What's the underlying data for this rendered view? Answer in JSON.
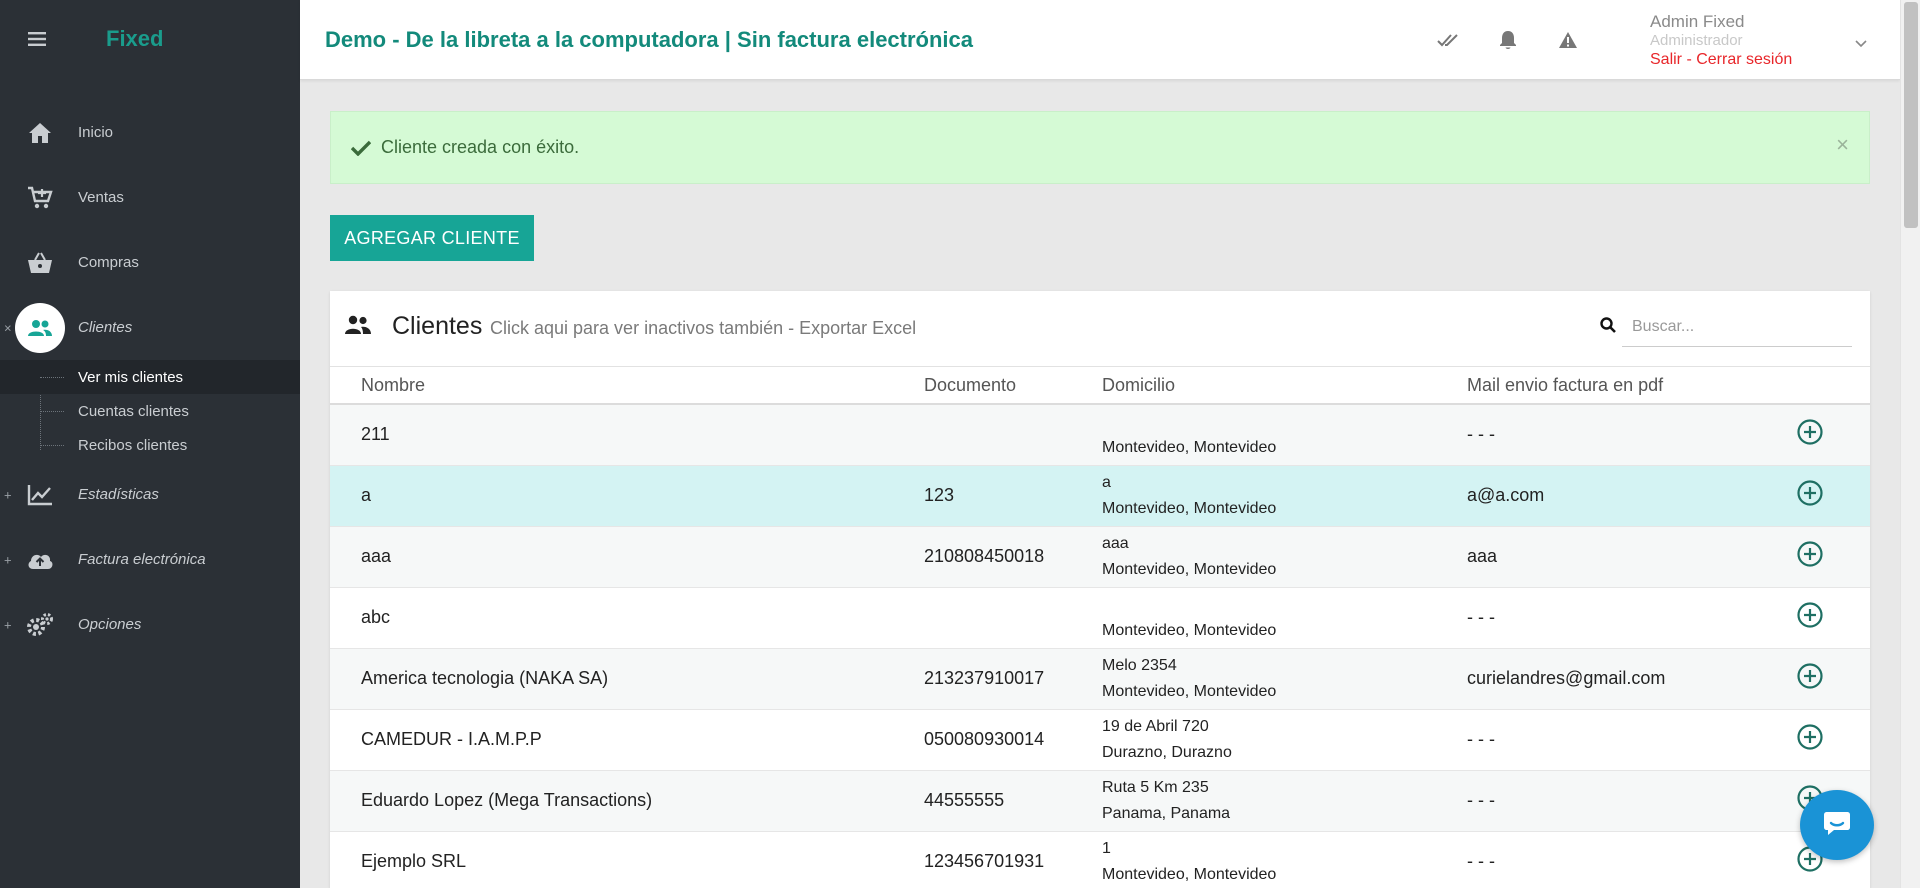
{
  "app": {
    "brand": "Fixed",
    "page_title": "Demo - De la libreta a la computadora | Sin factura electrónica"
  },
  "user": {
    "name": "Admin Fixed",
    "role": "Administrador",
    "logout": "Salir - Cerrar sesión"
  },
  "sidebar": {
    "items": [
      {
        "label": "Inicio",
        "icon": "home-icon"
      },
      {
        "label": "Ventas",
        "icon": "cart-icon"
      },
      {
        "label": "Compras",
        "icon": "basket-icon"
      },
      {
        "label": "Clientes",
        "icon": "users-icon",
        "marker": "×"
      },
      {
        "label": "Estadísticas",
        "icon": "chart-icon",
        "marker": "+"
      },
      {
        "label": "Factura electrónica",
        "icon": "cloud-upload-icon",
        "marker": "+"
      },
      {
        "label": "Opciones",
        "icon": "gears-icon",
        "marker": "+"
      }
    ],
    "clientes_sub": [
      "Ver mis clientes",
      "Cuentas clientes",
      "Recibos clientes"
    ]
  },
  "alert": {
    "message": "Cliente creada con éxito.",
    "close": "×"
  },
  "add_button": "AGREGAR CLIENTE",
  "card": {
    "title": "Clientes",
    "subtitle": "Click aqui para ver inactivos también - Exportar Excel",
    "search_placeholder": "Buscar..."
  },
  "table": {
    "headers": [
      "Nombre",
      "Documento",
      "Domicilio",
      "Mail envio factura en pdf"
    ],
    "rows": [
      {
        "nombre": "211",
        "documento": "",
        "dom1": "",
        "dom2": "Montevideo, Montevideo",
        "mail": "- - -"
      },
      {
        "nombre": "a",
        "documento": "123",
        "dom1": "a",
        "dom2": "Montevideo, Montevideo",
        "mail": "a@a.com"
      },
      {
        "nombre": "aaa",
        "documento": "210808450018",
        "dom1": "aaa",
        "dom2": "Montevideo, Montevideo",
        "mail": "aaa"
      },
      {
        "nombre": "abc",
        "documento": "",
        "dom1": "",
        "dom2": "Montevideo, Montevideo",
        "mail": "- - -"
      },
      {
        "nombre": "America tecnologia (NAKA SA)",
        "documento": "213237910017",
        "dom1": "Melo 2354",
        "dom2": "Montevideo, Montevideo",
        "mail": "curielandres@gmail.com"
      },
      {
        "nombre": "CAMEDUR - I.A.M.P.P",
        "documento": "050080930014",
        "dom1": "19 de Abril 720",
        "dom2": "Durazno, Durazno",
        "mail": "- - -"
      },
      {
        "nombre": "Eduardo Lopez (Mega Transactions)",
        "documento": "44555555",
        "dom1": "Ruta 5 Km 235",
        "dom2": "Panama, Panama",
        "mail": "- - -"
      },
      {
        "nombre": "Ejemplo SRL",
        "documento": "123456701931",
        "dom1": "1",
        "dom2": "Montevideo, Montevideo",
        "mail": "- - -"
      }
    ]
  },
  "colors": {
    "sidebar_bg": "#2b3036",
    "brand": "#1a9c8c",
    "accent": "#17a596",
    "alert_bg": "#d5fad5",
    "highlight_row": "#d4f3f3",
    "logout": "#e8262a"
  }
}
